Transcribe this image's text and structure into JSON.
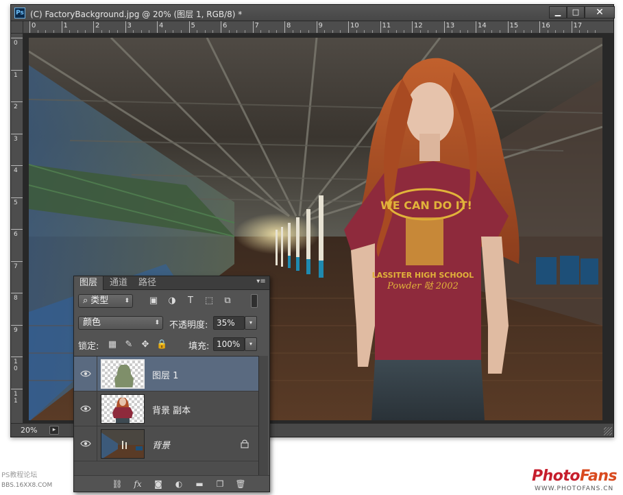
{
  "window": {
    "app_icon": "Ps",
    "title": "(C) FactoryBackground.jpg @ 20% (图层 1, RGB/8) *",
    "minimize_glyph": "▁",
    "maximize_glyph": "□",
    "close_glyph": "✕"
  },
  "ruler": {
    "top_labels": [
      "0",
      "1",
      "2",
      "3",
      "4",
      "5",
      "6",
      "7",
      "8",
      "9",
      "10",
      "11",
      "12",
      "13",
      "14",
      "15",
      "16",
      "17"
    ],
    "left_labels": [
      "0",
      "1",
      "2",
      "3",
      "4",
      "5",
      "6",
      "7",
      "8",
      "9",
      "10",
      "11"
    ]
  },
  "status": {
    "zoom": "20%"
  },
  "layers_panel": {
    "tabs": [
      "图层",
      "通道",
      "路径"
    ],
    "active_tab": 0,
    "filter_kind": "类型",
    "blend_mode": "颜色",
    "opacity_label": "不透明度:",
    "opacity_value": "35%",
    "lock_label": "锁定:",
    "fill_label": "填充:",
    "fill_value": "100%",
    "layers": [
      {
        "name": "图层 1",
        "selected": true,
        "visible": true,
        "locked": false,
        "italic": false
      },
      {
        "name": "背景 副本",
        "selected": false,
        "visible": true,
        "locked": false,
        "italic": false
      },
      {
        "name": "背景",
        "selected": false,
        "visible": true,
        "locked": true,
        "italic": true
      }
    ],
    "footer_icons": [
      "link-icon",
      "fx-icon",
      "mask-icon",
      "adjustment-icon",
      "folder-icon",
      "new-layer-icon",
      "trash-icon"
    ],
    "fx_label": "fx"
  },
  "canvas_art": {
    "shirt_text_1": "WE CAN DO IT!",
    "shirt_text_2": "LASSITER HIGH SCHOOL",
    "shirt_text_3": "Powder 哒 2002"
  },
  "watermark": {
    "left_line1": "PS教程论坛",
    "left_line2": "BBS.16XX8.COM",
    "brand_part1": "Photo",
    "brand_part2": "Fans",
    "brand_url": "WWW.PHOTOFANS.CN"
  },
  "colors": {
    "shirt": "#8e2a3c",
    "hair": "#b0502a",
    "selection": "#5a6a80",
    "brand": "#c61e2c"
  }
}
